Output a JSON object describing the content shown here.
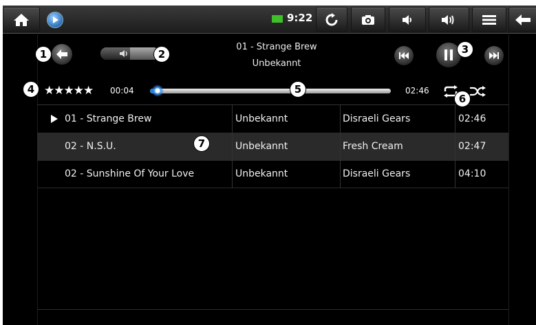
{
  "status_bar": {
    "time": "9:22",
    "icons": [
      "home-icon",
      "app-icon",
      "battery-icon",
      "refresh-icon",
      "camera-icon",
      "volume-down-icon",
      "volume-up-icon",
      "menu-icon",
      "back-arrow-icon"
    ]
  },
  "player": {
    "title": "01 - Strange Brew",
    "artist": "Unbekannt",
    "rating": "★★★★★",
    "elapsed": "00:04",
    "duration": "02:46",
    "progress_fraction": 0.03,
    "volume_fraction": 0.5
  },
  "tracks": [
    {
      "title": "01 - Strange Brew",
      "artist": "Unbekannt",
      "album": "Disraeli Gears",
      "duration": "02:46",
      "playing": true,
      "selected": false
    },
    {
      "title": "02 - N.S.U.",
      "artist": "Unbekannt",
      "album": "Fresh Cream",
      "duration": "02:47",
      "playing": false,
      "selected": true
    },
    {
      "title": "02 - Sunshine Of Your Love",
      "artist": "Unbekannt",
      "album": "Disraeli Gears",
      "duration": "04:10",
      "playing": false,
      "selected": false
    }
  ],
  "callouts": [
    "1",
    "2",
    "3",
    "4",
    "5",
    "6",
    "7"
  ],
  "colors": {
    "accent": "#2f7fd0",
    "battery": "#3fbf2a",
    "background": "#000000"
  }
}
